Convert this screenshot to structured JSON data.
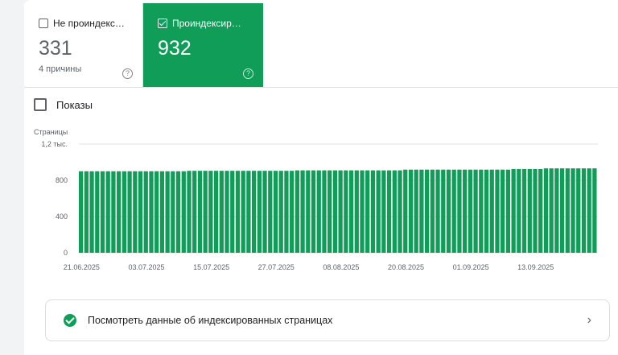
{
  "tiles": [
    {
      "label": "Не проиндексир...",
      "value": "331",
      "sub": "4 причины",
      "selected": false
    },
    {
      "label": "Проиндексирова...",
      "value": "932",
      "sub": "",
      "selected": true
    }
  ],
  "shows_label": "Показы",
  "link_label": "Посмотреть данные об индексированных страницах",
  "colors": {
    "accent": "#0f9d58",
    "grid": "#e0e0e0"
  },
  "chart_data": {
    "type": "bar",
    "ylabel": "Страницы",
    "y_ticks": [
      "0",
      "400",
      "800",
      "1,2 тыс."
    ],
    "ylim": [
      0,
      1200
    ],
    "x_ticks": [
      "21.06.2025",
      "03.07.2025",
      "15.07.2025",
      "27.07.2025",
      "08.08.2025",
      "20.08.2025",
      "01.09.2025",
      "13.09.2025"
    ],
    "values": [
      900,
      900,
      900,
      900,
      900,
      900,
      900,
      900,
      900,
      900,
      900,
      900,
      900,
      900,
      900,
      900,
      900,
      900,
      900,
      900,
      905,
      905,
      905,
      905,
      905,
      905,
      905,
      905,
      905,
      905,
      905,
      905,
      905,
      905,
      905,
      905,
      905,
      905,
      905,
      905,
      910,
      910,
      910,
      910,
      910,
      910,
      910,
      910,
      910,
      910,
      910,
      910,
      910,
      910,
      910,
      910,
      910,
      910,
      910,
      910,
      918,
      918,
      918,
      918,
      918,
      918,
      918,
      918,
      918,
      918,
      918,
      918,
      918,
      918,
      918,
      918,
      918,
      918,
      918,
      918,
      925,
      925,
      925,
      925,
      925,
      925,
      932,
      932,
      932,
      932,
      932,
      932,
      932,
      932,
      932,
      932
    ]
  }
}
